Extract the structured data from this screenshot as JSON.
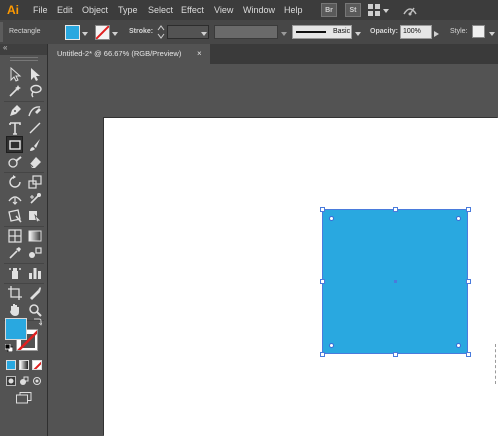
{
  "app": {
    "logo": "Ai"
  },
  "menubar": {
    "items": [
      "File",
      "Edit",
      "Object",
      "Type",
      "Select",
      "Effect",
      "View",
      "Window",
      "Help"
    ],
    "bridge_btn": "Br",
    "stock_btn": "St"
  },
  "controlbar": {
    "tool_name": "Rectangle",
    "stroke_label": "Stroke:",
    "brush_style": "Basic",
    "opacity_label": "Opacity:",
    "opacity_value": "100%",
    "style_label": "Style:"
  },
  "document": {
    "tab_title": "Untitled-2* @ 66.67% (RGB/Preview)",
    "close_glyph": "×"
  },
  "shape": {
    "fill_color": "#29a8e0"
  },
  "colors": {
    "fill": "#29a8e0",
    "stroke": "none",
    "accent": "#ff9a00",
    "selection": "#4a7bdc"
  }
}
